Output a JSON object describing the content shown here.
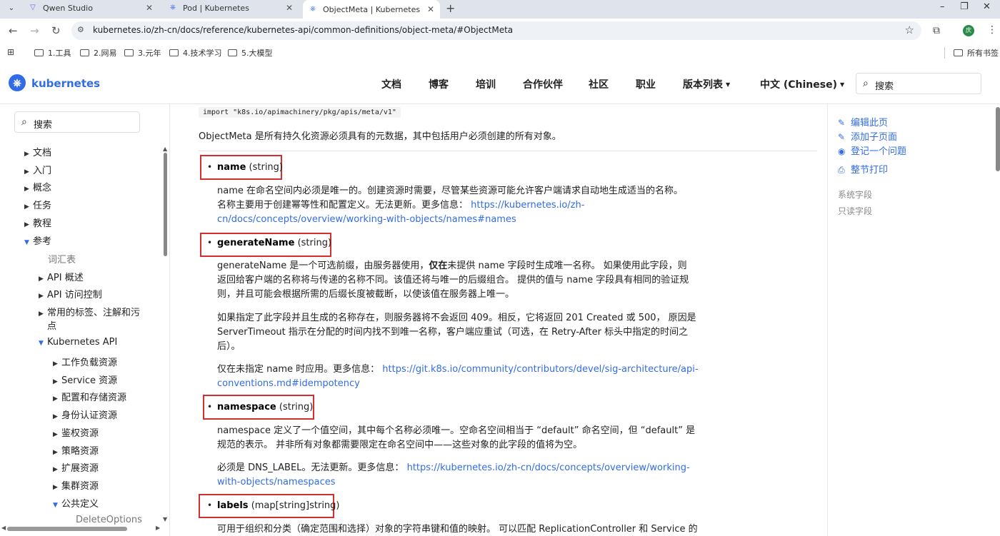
{
  "browser": {
    "tabs": [
      {
        "title": "Qwen Studio",
        "icon": "qwen-icon"
      },
      {
        "title": "Pod | Kubernetes",
        "icon": "k8s-favicon"
      },
      {
        "title": "ObjectMeta | Kubernetes",
        "icon": "k8s-favicon"
      }
    ],
    "url": "kubernetes.io/zh-cn/docs/reference/kubernetes-api/common-definitions/object-meta/#ObjectMeta",
    "profile_initial": "庆",
    "bookmarks": [
      "1.工具",
      "2.网易",
      "3.元年",
      "4.技术学习",
      "5.大模型"
    ],
    "all_bookmarks": "所有书签"
  },
  "site": {
    "logo_text": "kubernetes",
    "nav": [
      "文档",
      "博客",
      "培训",
      "合作伙伴",
      "社区",
      "职业",
      "版本列表",
      "中文 (Chinese)"
    ],
    "search_label": "搜索"
  },
  "sidebar": {
    "search_label": "搜索",
    "items": [
      {
        "label": "文档",
        "arrow": "▶"
      },
      {
        "label": "入门",
        "arrow": "▶"
      },
      {
        "label": "概念",
        "arrow": "▶"
      },
      {
        "label": "任务",
        "arrow": "▶"
      },
      {
        "label": "教程",
        "arrow": "▶"
      },
      {
        "label": "参考",
        "arrow": "▼"
      },
      {
        "label": "词汇表",
        "arrow": ""
      },
      {
        "label": "API 概述",
        "arrow": "▶"
      },
      {
        "label": "API 访问控制",
        "arrow": "▶"
      },
      {
        "label": "常用的标签、注解和污",
        "arrow": "▶"
      },
      {
        "label": "点",
        "arrow": ""
      },
      {
        "label": "Kubernetes API",
        "arrow": "▼"
      },
      {
        "label": "工作负载资源",
        "arrow": "▶"
      },
      {
        "label": "Service 资源",
        "arrow": "▶"
      },
      {
        "label": "配置和存储资源",
        "arrow": "▶"
      },
      {
        "label": "身份认证资源",
        "arrow": "▶"
      },
      {
        "label": "鉴权资源",
        "arrow": "▶"
      },
      {
        "label": "策略资源",
        "arrow": "▶"
      },
      {
        "label": "扩展资源",
        "arrow": "▶"
      },
      {
        "label": "集群资源",
        "arrow": "▶"
      },
      {
        "label": "公共定义",
        "arrow": "▼"
      },
      {
        "label": "DeleteOptions",
        "arrow": ""
      }
    ]
  },
  "main": {
    "import_code": "import \"k8s.io/apimachinery/pkg/apis/meta/v1\"",
    "intro": "ObjectMeta 是所有持久化资源必须具有的元数据，其中包括用户必须创建的所有对象。",
    "fields": [
      {
        "name": "name",
        "type": "(string)"
      },
      {
        "name": "generateName",
        "type": "(string)"
      },
      {
        "name": "namespace",
        "type": "(string)"
      },
      {
        "name": "labels",
        "type": "(map[string]string)"
      }
    ],
    "name_desc": {
      "l1": "name 在命名空间内必须是唯一的。创建资源时需要，尽管某些资源可能允许客户端请求自动地生成适当的名称。",
      "l2": "名称主要用于创建幂等性和配置定义。无法更新。更多信息：",
      "link_a": "https://kubernetes.io/zh-",
      "link_b": "cn/docs/concepts/overview/working-with-objects/names#names"
    },
    "gen_desc1": {
      "l1_pre": "generateName 是一个可选前缀，由服务器使用，",
      "l1_bold": "仅在",
      "l1_post": "未提供 name 字段时生成唯一名称。 如果使用此字段，则",
      "l2": "返回给客户端的名称将与传递的名称不同。该值还将与唯一的后缀组合。 提供的值与 name 字段具有相同的验证规",
      "l3": "则，并且可能会根据所需的后缀长度被截断，以使该值在服务器上唯一。"
    },
    "gen_desc2": {
      "l1": "如果指定了此字段并且生成的名称存在，则服务器将不会返回 409。相反，它将返回 201 Created 或 500， 原因是",
      "l2": "ServerTimeout 指示在分配的时间内找不到唯一名称，客户端应重试（可选，在 Retry-After 标头中指定的时间之",
      "l3": "后）。"
    },
    "gen_desc3": {
      "l1_pre": "仅在未指定 name 时应用。更多信息：",
      "link_a": "https://git.k8s.io/community/contributors/devel/sig-architecture/api-",
      "link_b": "conventions.md#idempotency"
    },
    "ns_desc1": {
      "l1": "namespace 定义了一个值空间，其中每个名称必须唯一。空命名空间相当于 “default” 命名空间，但 “default” 是",
      "l2": "规范的表示。 并非所有对象都需要限定在命名空间中——这些对象的此字段的值将为空。"
    },
    "ns_desc2": {
      "l1_pre": "必须是 DNS_LABEL。无法更新。更多信息：",
      "link_a": "https://kubernetes.io/zh-cn/docs/concepts/overview/working-",
      "link_b": "with-objects/namespaces"
    },
    "labels_desc": "可用于组织和分类（确定范围和选择）对象的字符串键和值的映射。 可以匹配 ReplicationController 和 Service 的"
  },
  "toc": {
    "actions": [
      {
        "label": "编辑此页",
        "icon": "edit-icon"
      },
      {
        "label": "添加子页面",
        "icon": "edit-icon"
      },
      {
        "label": "登记一个问题",
        "icon": "github-icon"
      },
      {
        "label": "整节打印",
        "icon": "print-icon"
      }
    ],
    "sections": [
      "系统字段",
      "只读字段"
    ]
  }
}
